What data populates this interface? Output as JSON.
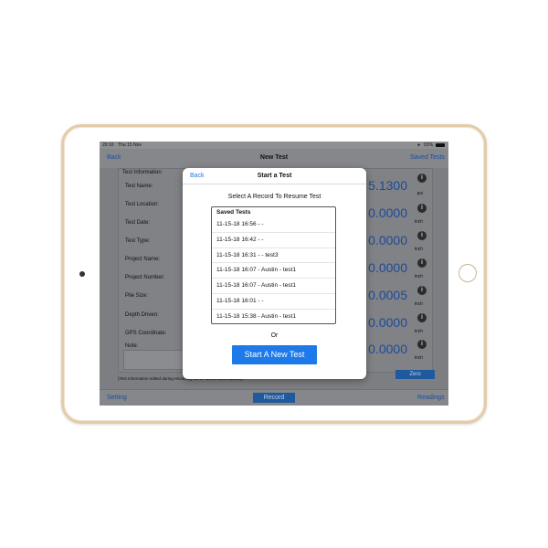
{
  "statusbar": {
    "time": "20:10",
    "date": "Thu 15 Nov",
    "battery": "91%"
  },
  "navbar": {
    "back_label": "Back",
    "title": "New Test",
    "saved_label": "Saved Tests"
  },
  "form": {
    "header": "Test Information",
    "fields": [
      "Test Name:",
      "Test Location:",
      "Test Date:",
      "Test Type:",
      "Project Name:",
      "Project Number:",
      "Pile Size:",
      "Depth Driven:",
      "GPS Coordinate:",
      "Note:"
    ],
    "autosave_note": "(Test Information edited during recording will be saved automatically)"
  },
  "readings": [
    {
      "value": "5.1300",
      "unit": "psi"
    },
    {
      "value": "0.0000",
      "unit": "inch"
    },
    {
      "value": "0.0000",
      "unit": "inch"
    },
    {
      "value": "0.0000",
      "unit": "inch"
    },
    {
      "value": "0.0005",
      "unit": "inch"
    },
    {
      "value": "0.0000",
      "unit": "inch"
    },
    {
      "value": "0.0000",
      "unit": "inch"
    }
  ],
  "zero_label": "Zero",
  "tabbar": {
    "setting_label": "Setting",
    "record_label": "Record",
    "readings_label": "Readings"
  },
  "modal": {
    "back_label": "Back",
    "title": "Start a Test",
    "subtitle": "Select A Record To Resume Test",
    "saved_header": "Saved Tests",
    "saved_items": [
      "11-15-18 16:56 -  -",
      "11-15-18 16:42 -  -",
      "11-15-18 16:31 -  - test3",
      "11-15-18 16:07 - Austin  - test1",
      "11-15-18 16:07 - Austin  - test1",
      "11-15-18 16:01 -  -",
      "11-15-18 15:38 - Austin  - test1"
    ],
    "or_label": "Or",
    "start_label": "Start A New Test"
  },
  "colors": {
    "accent": "#1e7ae8",
    "dim_accent": "#1f5a9f",
    "device_trim": "#e3ccaa"
  }
}
